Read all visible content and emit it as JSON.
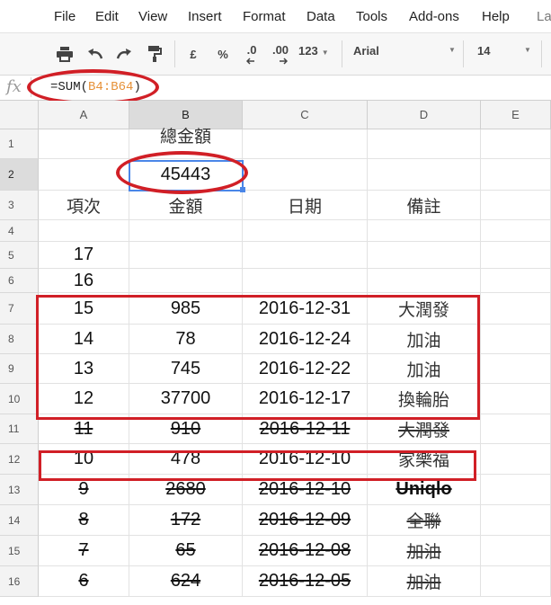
{
  "menu": [
    "File",
    "Edit",
    "View",
    "Insert",
    "Format",
    "Data",
    "Tools",
    "Add-ons",
    "Help",
    "La"
  ],
  "toolbar": {
    "currency": "£",
    "percent": "%",
    "decrease_decimal": ".0",
    "increase_decimal": ".00",
    "more_formats": "123",
    "font": "Arial",
    "font_size": "14"
  },
  "formula_bar": {
    "fx": "fx",
    "prefix": "=SUM(",
    "range": "B4:B64",
    "suffix": ")"
  },
  "columns": [
    "A",
    "B",
    "C",
    "D",
    "E"
  ],
  "rows": [
    {
      "n": "1",
      "a": "",
      "b": "總金額",
      "c": "",
      "d": ""
    },
    {
      "n": "2",
      "a": "",
      "b": "45443",
      "c": "",
      "d": ""
    },
    {
      "n": "3",
      "a": "項次",
      "b": "金額",
      "c": "日期",
      "d": "備註"
    },
    {
      "n": "4",
      "a": "",
      "b": "",
      "c": "",
      "d": ""
    },
    {
      "n": "5",
      "a": "17",
      "b": "",
      "c": "",
      "d": ""
    },
    {
      "n": "6",
      "a": "16",
      "b": "",
      "c": "",
      "d": ""
    },
    {
      "n": "7",
      "a": "15",
      "b": "985",
      "c": "2016-12-31",
      "d": "大潤發"
    },
    {
      "n": "8",
      "a": "14",
      "b": "78",
      "c": "2016-12-24",
      "d": "加油"
    },
    {
      "n": "9",
      "a": "13",
      "b": "745",
      "c": "2016-12-22",
      "d": "加油"
    },
    {
      "n": "10",
      "a": "12",
      "b": "37700",
      "c": "2016-12-17",
      "d": "換輪胎"
    },
    {
      "n": "11",
      "a": "11",
      "b": "910",
      "c": "2016-12-11",
      "d": "大潤發",
      "strike": true
    },
    {
      "n": "12",
      "a": "10",
      "b": "478",
      "c": "2016-12-10",
      "d": "家樂福"
    },
    {
      "n": "13",
      "a": "9",
      "b": "2680",
      "c": "2016-12-10",
      "d": "Uniqlo",
      "strike": true
    },
    {
      "n": "14",
      "a": "8",
      "b": "172",
      "c": "2016-12-09",
      "d": "全聯",
      "strike": true
    },
    {
      "n": "15",
      "a": "7",
      "b": "65",
      "c": "2016-12-08",
      "d": "加油",
      "strike": true
    },
    {
      "n": "16",
      "a": "6",
      "b": "624",
      "c": "2016-12-05",
      "d": "加油",
      "strike": true
    }
  ],
  "selected_cell": "B2",
  "colors": {
    "annotation_red": "#d11f26",
    "selection_blue": "#4a86e8",
    "range_orange": "#e69138"
  }
}
